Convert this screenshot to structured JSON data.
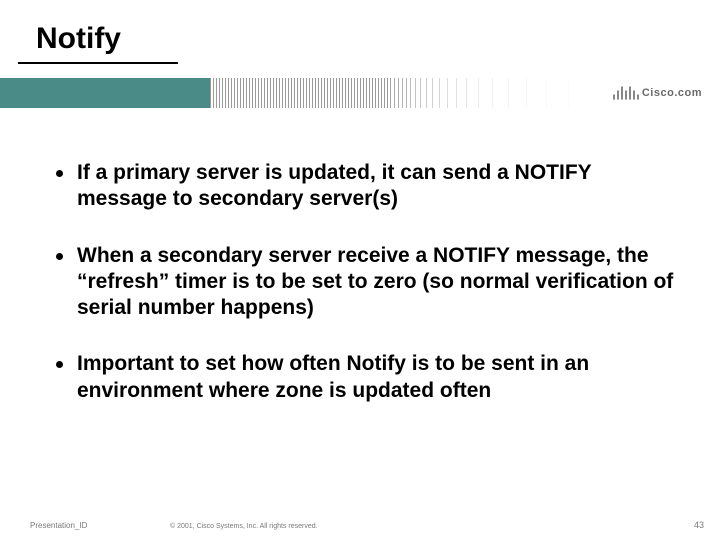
{
  "title": "Notify",
  "brand": "Cisco.com",
  "bullets": [
    "If a primary server is updated, it can send a NOTIFY message to secondary server(s)",
    "When a secondary server receive a NOTIFY message, the “refresh” timer is to be set to zero (so normal verification of serial number happens)",
    "Important to set how often Notify is to be sent in an environment where zone is updated often"
  ],
  "footer": {
    "left": "Presentation_ID",
    "center": "© 2001, Cisco Systems, Inc. All rights reserved.",
    "page": "43"
  }
}
